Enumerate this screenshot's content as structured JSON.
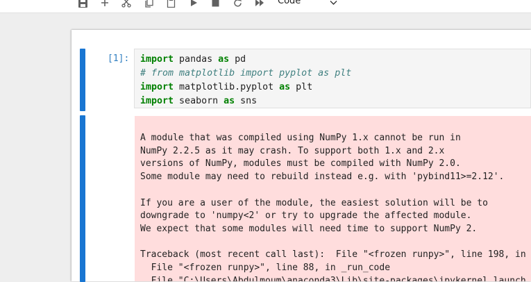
{
  "toolbar": {
    "buttons": [
      "save-icon",
      "add-icon",
      "cut-icon",
      "copy-icon",
      "paste-icon",
      "run-icon",
      "stop-icon",
      "restart-icon",
      "fast-forward-icon"
    ],
    "cell_type": "Code"
  },
  "cell": {
    "prompt": "[1]:",
    "code": {
      "line1": {
        "kw1": "import",
        "t1": " pandas ",
        "kw2": "as",
        "t2": " pd"
      },
      "line2": {
        "comment": "# from matplotlib import pyplot as plt"
      },
      "line3": {
        "kw1": "import",
        "t1": " matplotlib.pyplot ",
        "kw2": "as",
        "t2": " plt"
      },
      "line4": {
        "kw1": "import",
        "t1": " seaborn ",
        "kw2": "as",
        "t2": " sns"
      }
    },
    "output_lines": [
      "A module that was compiled using NumPy 1.x cannot be run in",
      "NumPy 2.2.5 as it may crash. To support both 1.x and 2.x",
      "versions of NumPy, modules must be compiled with NumPy 2.0.",
      "Some module may need to rebuild instead e.g. with 'pybind11>=2.12'.",
      "",
      "If you are a user of the module, the easiest solution will be to",
      "downgrade to 'numpy<2' or try to upgrade the affected module.",
      "We expect that some modules will need time to support NumPy 2.",
      "",
      "Traceback (most recent call last):  File \"<frozen runpy>\", line 198, in",
      "  File \"<frozen runpy>\", line 88, in _run_code",
      "  File \"C:\\Users\\Abdulmoum\\anaconda3\\Lib\\site-packages\\ipykernel_launch"
    ]
  }
}
